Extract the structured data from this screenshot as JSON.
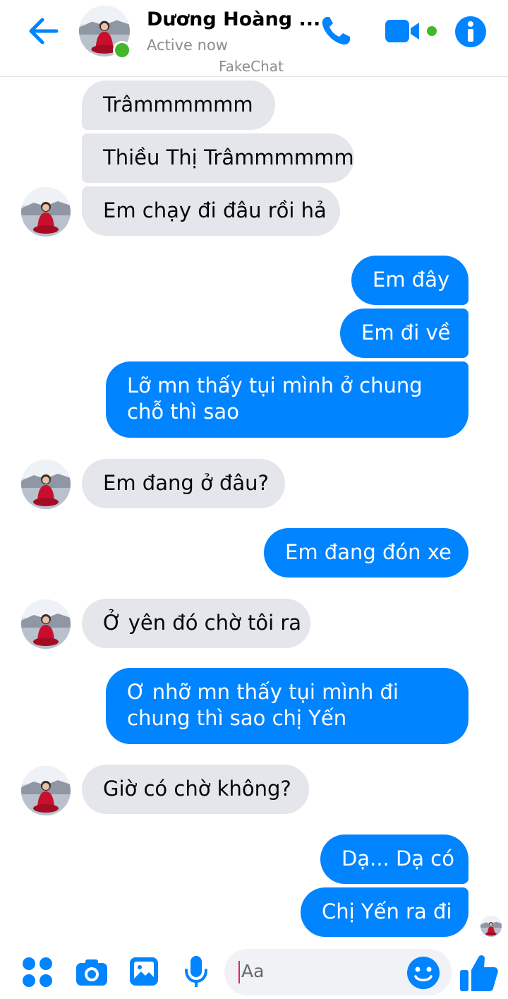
{
  "header": {
    "title": "Dương Hoàng ...",
    "status": "Active now",
    "watermark": "FakeChat"
  },
  "colors": {
    "accent": "#0084ff",
    "incoming_bubble": "#e4e6eb",
    "online": "#42b72a"
  },
  "icons": {
    "back": "arrow-left-icon",
    "call": "phone-icon",
    "video": "video-camera-icon",
    "info": "info-icon",
    "menu": "four-dots-icon",
    "camera": "camera-icon",
    "gallery": "image-icon",
    "mic": "microphone-icon",
    "emoji": "smiley-icon",
    "like": "thumbs-up-icon"
  },
  "messages": [
    {
      "side": "in",
      "text": "Trâmmmmmm"
    },
    {
      "side": "in",
      "text": "Thiều Thị Trâmmmmmm"
    },
    {
      "side": "in",
      "text": "Em chạy đi đâu rồi hả"
    },
    {
      "side": "out",
      "text": "Em đây"
    },
    {
      "side": "out",
      "text": "Em đi về"
    },
    {
      "side": "out",
      "text": "Lỡ mn thấy tụi mình ở chung",
      "text2": "chỗ thì sao"
    },
    {
      "side": "in",
      "text": "Em đang ở đâu?"
    },
    {
      "side": "out",
      "text": "Em đang đón xe"
    },
    {
      "side": "in",
      "text": "Ở yên đó chờ tôi ra"
    },
    {
      "side": "out",
      "text": "Ơ nhỡ mn thấy tụi mình đi",
      "text2": "chung thì sao chị Yến"
    },
    {
      "side": "in",
      "text": "Giờ có chờ không?"
    },
    {
      "side": "out",
      "text": "Dạ... Dạ có"
    },
    {
      "side": "out",
      "text": "Chị Yến ra đi"
    }
  ],
  "composer": {
    "placeholder": "Aa"
  }
}
